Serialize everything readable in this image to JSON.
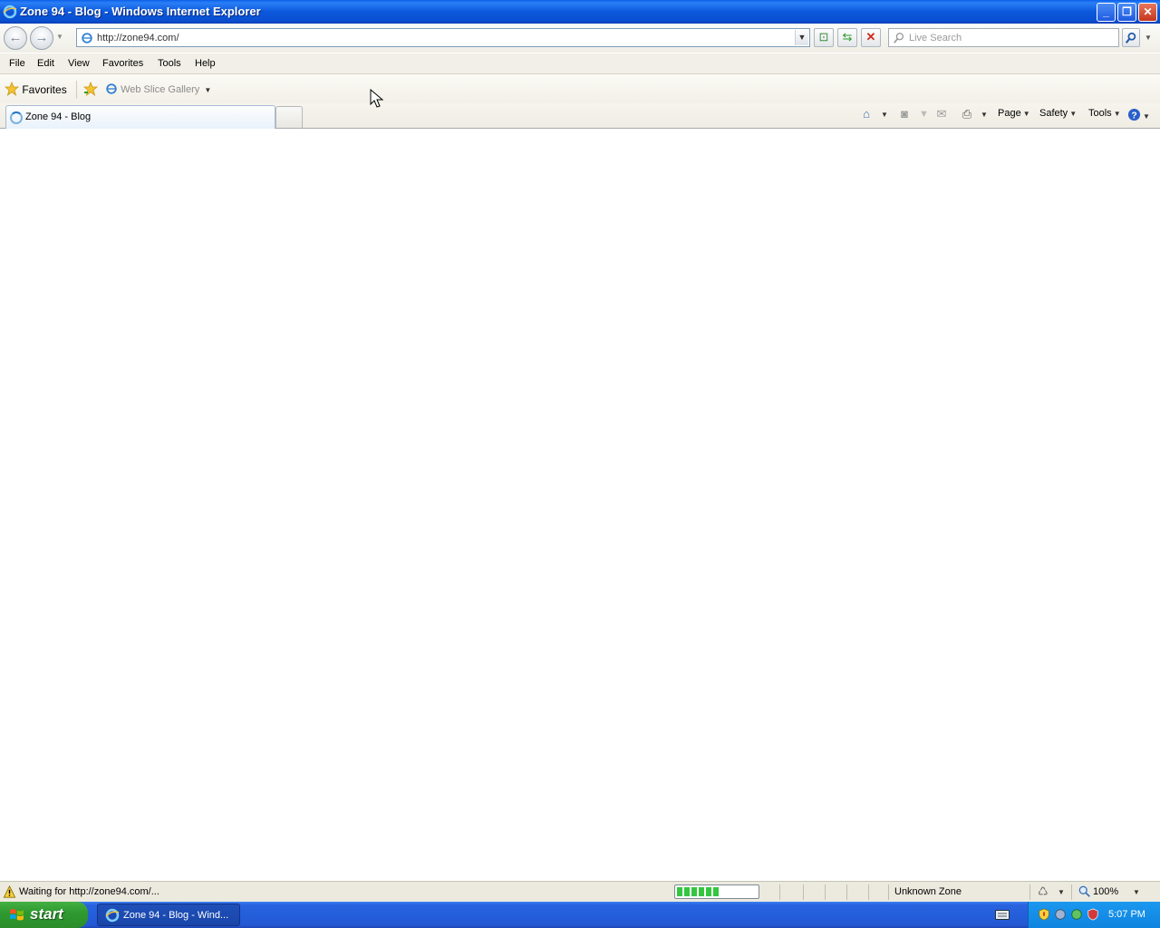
{
  "window": {
    "title": "Zone 94 - Blog - Windows Internet Explorer",
    "controls": {
      "minimize": "_",
      "restore": "❐",
      "close": "✕"
    }
  },
  "address_bar": {
    "url": "http://zone94.com/"
  },
  "search": {
    "placeholder": "Live Search"
  },
  "menu": {
    "items": [
      "File",
      "Edit",
      "View",
      "Favorites",
      "Tools",
      "Help"
    ]
  },
  "favorites_bar": {
    "favorites_label": "Favorites",
    "web_slice_label": "Web Slice Gallery"
  },
  "tabs": {
    "active_label": "Zone 94 - Blog"
  },
  "command_bar": {
    "page_label": "Page",
    "safety_label": "Safety",
    "tools_label": "Tools"
  },
  "status_bar": {
    "text": "Waiting for http://zone94.com/...",
    "progress": 0.55,
    "zone": "Unknown Zone",
    "zoom": "100%"
  },
  "taskbar": {
    "start_label": "start",
    "task_label": "Zone 94 - Blog - Wind...",
    "clock": "5:07 PM"
  },
  "colors": {
    "titlebar": "#0b58dc",
    "taskbar": "#245edb",
    "start": "#2f9a30",
    "tray": "#0f84e0",
    "progress": "#35c640"
  },
  "icons": [
    "ie-icon",
    "back-icon",
    "forward-icon",
    "refresh-icon",
    "stop-icon",
    "search-icon",
    "favorites-star-icon",
    "add-favorite-icon",
    "home-icon",
    "feeds-icon",
    "mail-icon",
    "print-icon",
    "help-icon",
    "warning-icon",
    "zoom-icon",
    "windows-flag-icon"
  ]
}
